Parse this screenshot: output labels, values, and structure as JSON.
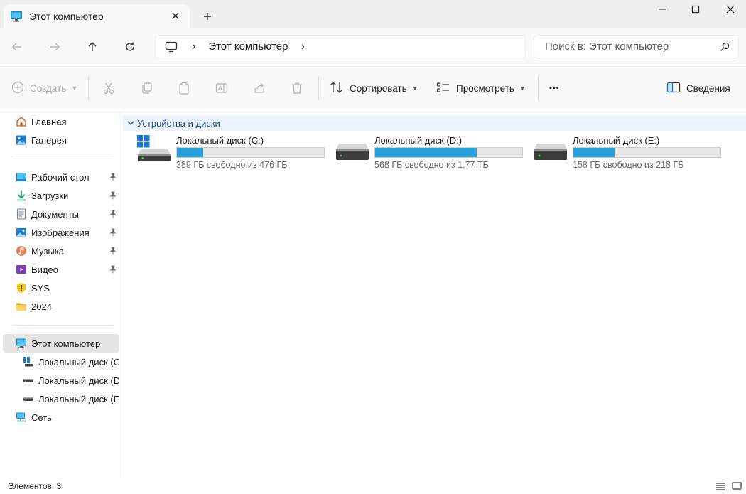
{
  "window": {
    "tab_title": "Этот компьютер",
    "new_tab_label": "+",
    "close_tab_label": "✕"
  },
  "navigation": {
    "breadcrumb": [
      "Этот компьютер"
    ],
    "search_placeholder": "Поиск в: Этот компьютер"
  },
  "commands": {
    "create": "Создать",
    "sort": "Сортировать",
    "view": "Просмотреть",
    "more": "•••",
    "details": "Сведения"
  },
  "sidebar": {
    "quick": [
      {
        "label": "Главная",
        "icon": "home-icon"
      },
      {
        "label": "Галерея",
        "icon": "gallery-icon"
      }
    ],
    "pinned": [
      {
        "label": "Рабочий стол",
        "icon": "desktop-icon",
        "pinned": true
      },
      {
        "label": "Загрузки",
        "icon": "download-icon",
        "pinned": true
      },
      {
        "label": "Документы",
        "icon": "documents-icon",
        "pinned": true
      },
      {
        "label": "Изображения",
        "icon": "pictures-icon",
        "pinned": true
      },
      {
        "label": "Музыка",
        "icon": "music-icon",
        "pinned": true
      },
      {
        "label": "Видео",
        "icon": "video-icon",
        "pinned": true
      },
      {
        "label": "SYS",
        "icon": "warning-drive-icon",
        "pinned": false
      },
      {
        "label": "2024",
        "icon": "folder-icon",
        "pinned": false
      }
    ],
    "this_pc": "Этот компьютер",
    "drives": [
      {
        "label": "Локальный диск (C:",
        "icon": "windows-drive-icon"
      },
      {
        "label": "Локальный диск (D",
        "icon": "drive-icon"
      },
      {
        "label": "Локальный диск (E:",
        "icon": "drive-icon"
      }
    ],
    "network": "Сеть"
  },
  "content": {
    "group_title": "Устройства и диски",
    "drives": [
      {
        "name": "Локальный диск (C:)",
        "free_text": "389 ГБ свободно из 476 ГБ",
        "used_fraction": 0.18,
        "system": true
      },
      {
        "name": "Локальный диск (D:)",
        "free_text": "568 ГБ свободно из 1,77 ТБ",
        "used_fraction": 0.69,
        "system": false
      },
      {
        "name": "Локальный диск (E:)",
        "free_text": "158 ГБ свободно из 218 ГБ",
        "used_fraction": 0.28,
        "system": false
      }
    ]
  },
  "status": {
    "items_count": "Элементов: 3"
  },
  "colors": {
    "accent": "#26a0da",
    "group_header_bg": "#eaf2fb",
    "selected_bg": "#e5e5e5"
  }
}
